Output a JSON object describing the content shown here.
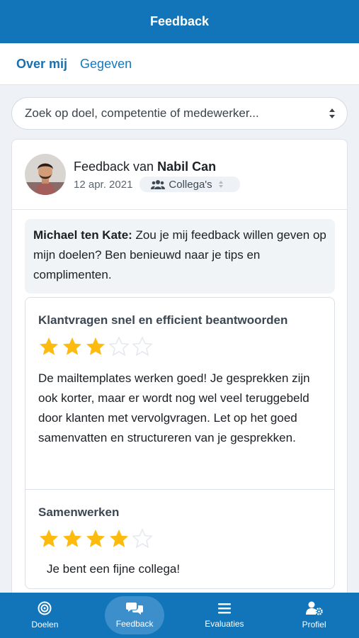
{
  "header": {
    "title": "Feedback"
  },
  "tabs": [
    {
      "label": "Over mij",
      "active": true
    },
    {
      "label": "Gegeven",
      "active": false
    }
  ],
  "search": {
    "placeholder": "Zoek op doel, competentie of medewerker..."
  },
  "card": {
    "from_prefix": "Feedback van",
    "from_name": "Nabil Can",
    "date": "12 apr. 2021",
    "audience": "Collega's",
    "request": {
      "author": "Michael ten Kate:",
      "text": "Zou je mij feedback willen geven op mijn doelen? Ben benieuwd naar je tips en complimenten."
    },
    "items": [
      {
        "title": "Klantvragen snel en efficient beantwoorden",
        "rating": 3,
        "max": 5,
        "text": "De mailtemplates werken goed! Je gesprekken zijn ook korter, maar er wordt nog wel veel teruggebeld door klanten met vervolgvragen. Let op het goed samenvatten en structureren van je gesprekken."
      },
      {
        "title": "Samenwerken",
        "rating": 4,
        "max": 5,
        "text": "Je bent een fijne collega!"
      }
    ]
  },
  "bottom_nav": [
    {
      "label": "Doelen",
      "icon": "target-icon",
      "active": false
    },
    {
      "label": "Feedback",
      "icon": "chat-bubbles-icon",
      "active": true
    },
    {
      "label": "Evaluaties",
      "icon": "list-icon",
      "active": false
    },
    {
      "label": "Profiel",
      "icon": "user-gear-icon",
      "active": false
    }
  ],
  "colors": {
    "primary": "#1275b9",
    "star": "#fdbb0f",
    "star_empty": "#e4e8ee"
  }
}
